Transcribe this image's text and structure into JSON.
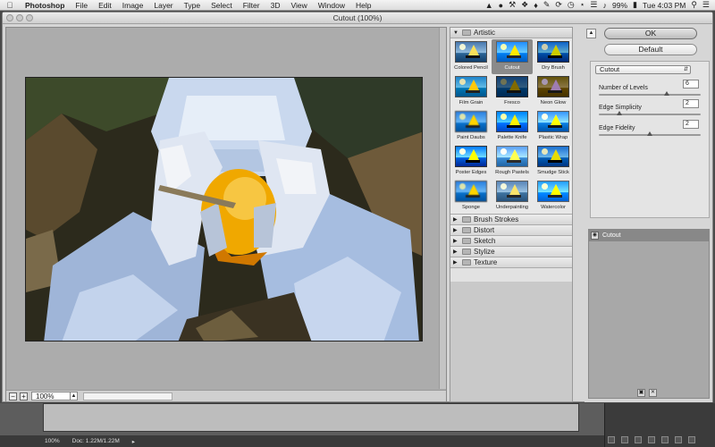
{
  "menubar": {
    "app": "Photoshop",
    "items": [
      "File",
      "Edit",
      "Image",
      "Layer",
      "Type",
      "Select",
      "Filter",
      "3D",
      "View",
      "Window",
      "Help"
    ],
    "battery": "99%",
    "clock": "Tue 4:03 PM"
  },
  "window": {
    "title": "Cutout (100%)"
  },
  "preview": {
    "zoom": "100%"
  },
  "gallery": {
    "open_category": "Artistic",
    "filters": [
      "Colored Pencil",
      "Cutout",
      "Dry Brush",
      "Film Grain",
      "Fresco",
      "Neon Glow",
      "Paint Daubs",
      "Palette Knife",
      "Plastic Wrap",
      "Poster Edges",
      "Rough Pastels",
      "Smudge Stick",
      "Sponge",
      "Underpainting",
      "Watercolor"
    ],
    "selected_filter": "Cutout",
    "categories": [
      "Brush Strokes",
      "Distort",
      "Sketch",
      "Stylize",
      "Texture"
    ]
  },
  "settings": {
    "ok_label": "OK",
    "default_label": "Default",
    "filter_select": "Cutout",
    "params": [
      {
        "label": "Number of Levels",
        "value": "6",
        "fraction": 0.67
      },
      {
        "label": "Edge Simplicity",
        "value": "2",
        "fraction": 0.2
      },
      {
        "label": "Edge Fidelity",
        "value": "2",
        "fraction": 0.5
      }
    ],
    "layer_name": "Cutout"
  },
  "status": {
    "zoom": "100%",
    "doc": "Doc: 1.22M/1.22M"
  }
}
